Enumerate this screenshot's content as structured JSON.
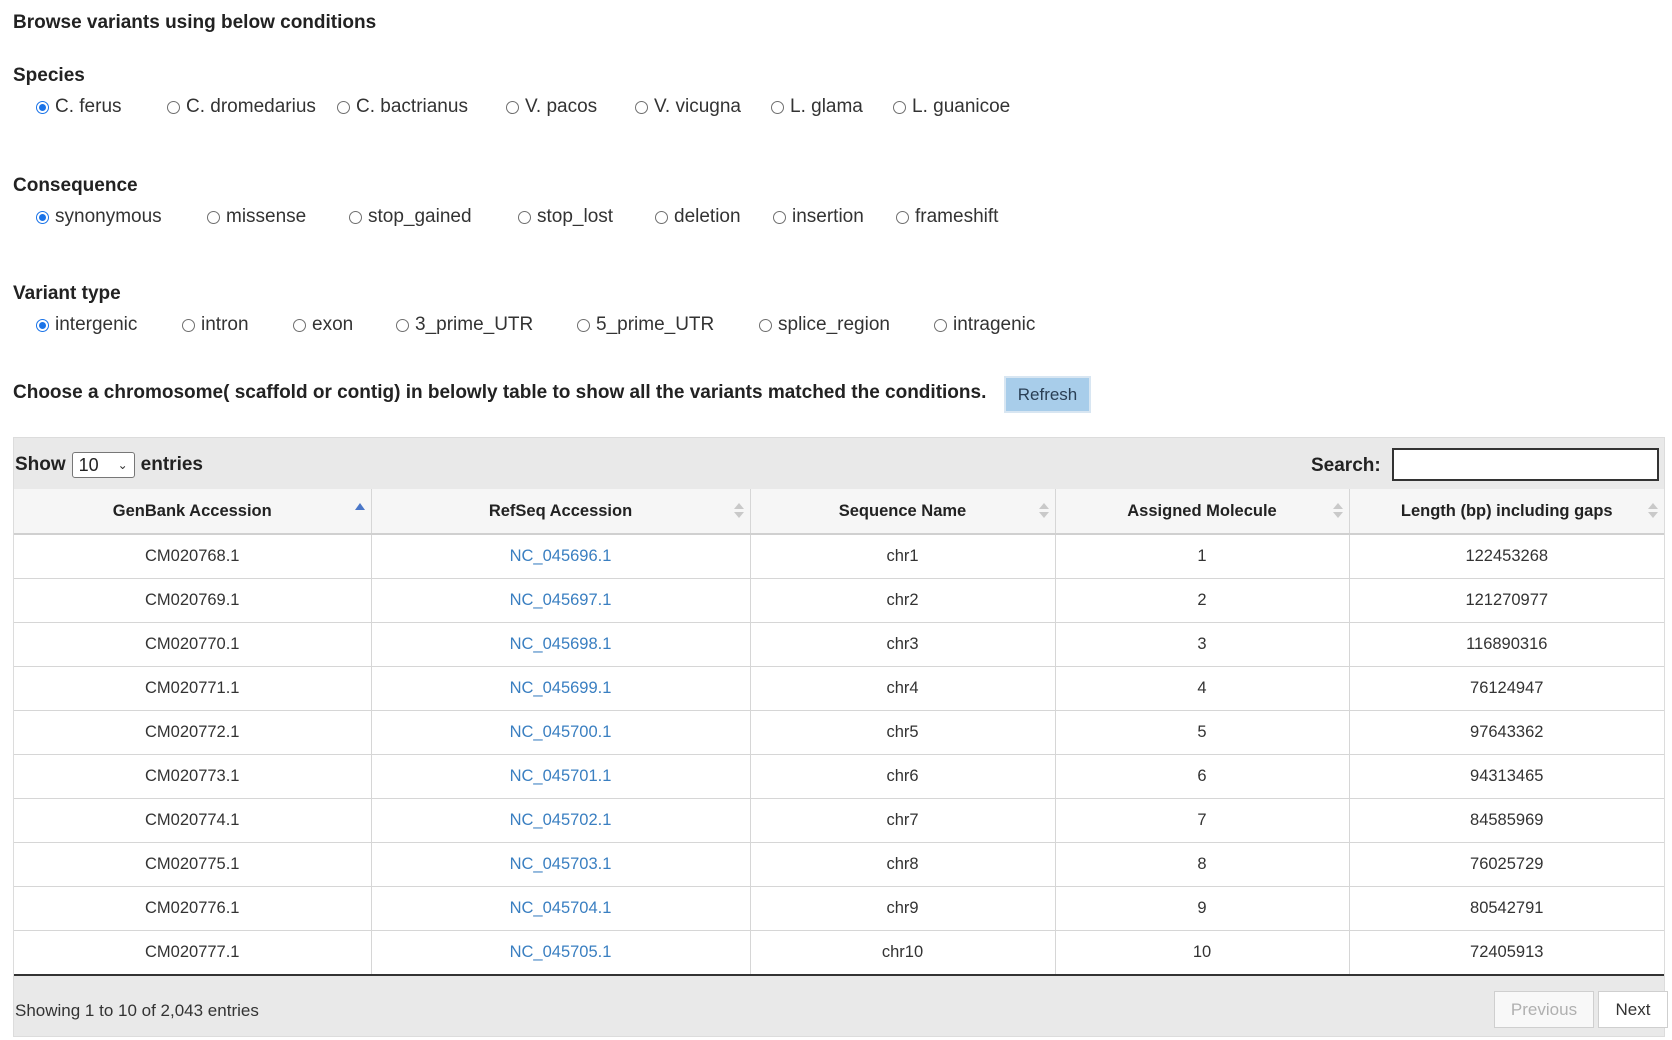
{
  "heading": "Browse variants using below conditions",
  "species": {
    "title": "Species",
    "options": [
      "C. ferus",
      "C. dromedarius",
      "C. bactrianus",
      "V. pacos",
      "V. vicugna",
      "L. glama",
      "L. guanicoe"
    ],
    "selected": "C. ferus"
  },
  "consequence": {
    "title": "Consequence",
    "options": [
      "synonymous",
      "missense",
      "stop_gained",
      "stop_lost",
      "deletion",
      "insertion",
      "frameshift"
    ],
    "selected": "synonymous"
  },
  "variant_type": {
    "title": "Variant type",
    "options": [
      "intergenic",
      "intron",
      "exon",
      "3_prime_UTR",
      "5_prime_UTR",
      "splice_region",
      "intragenic"
    ],
    "selected": "intergenic"
  },
  "choose_text": "Choose a chromosome( scaffold or contig) in belowly table to show all the variants matched the conditions.",
  "refresh_label": "Refresh",
  "table": {
    "show_label": "Show",
    "entries_label": "entries",
    "page_length": "10",
    "search_label": "Search:",
    "search_value": "",
    "columns": [
      "GenBank Accession",
      "RefSeq Accession",
      "Sequence Name",
      "Assigned Molecule",
      "Length (bp) including gaps"
    ],
    "sorted_column": "GenBank Accession",
    "sort_direction": "ascending",
    "rows": [
      [
        "CM020768.1",
        "NC_045696.1",
        "chr1",
        "1",
        "122453268"
      ],
      [
        "CM020769.1",
        "NC_045697.1",
        "chr2",
        "2",
        "121270977"
      ],
      [
        "CM020770.1",
        "NC_045698.1",
        "chr3",
        "3",
        "116890316"
      ],
      [
        "CM020771.1",
        "NC_045699.1",
        "chr4",
        "4",
        "76124947"
      ],
      [
        "CM020772.1",
        "NC_045700.1",
        "chr5",
        "5",
        "97643362"
      ],
      [
        "CM020773.1",
        "NC_045701.1",
        "chr6",
        "6",
        "94313465"
      ],
      [
        "CM020774.1",
        "NC_045702.1",
        "chr7",
        "7",
        "84585969"
      ],
      [
        "CM020775.1",
        "NC_045703.1",
        "chr8",
        "8",
        "76025729"
      ],
      [
        "CM020776.1",
        "NC_045704.1",
        "chr9",
        "9",
        "80542791"
      ],
      [
        "CM020777.1",
        "NC_045705.1",
        "chr10",
        "10",
        "72405913"
      ]
    ],
    "info": "Showing 1 to 10 of 2,043 entries",
    "previous_label": "Previous",
    "next_label": "Next"
  },
  "colors": {
    "radio_checked": "#1a73e8",
    "link": "#3a7fc1",
    "refresh_bg": "#a8cdea",
    "panel_bg": "#e9e9e9"
  }
}
